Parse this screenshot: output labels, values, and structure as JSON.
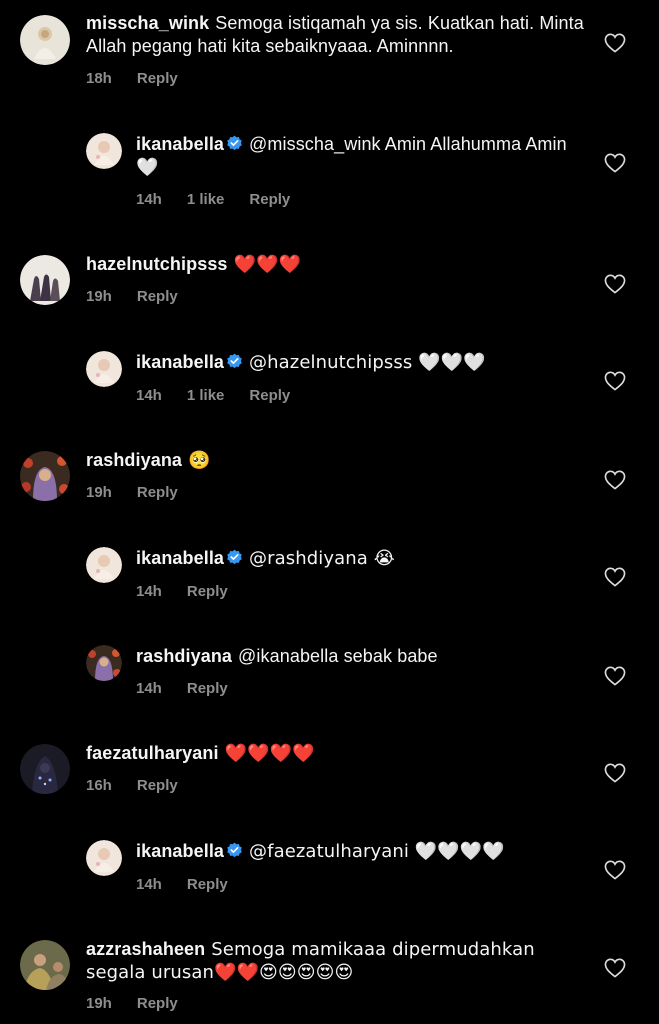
{
  "colors": {
    "background": "#000000",
    "text": "#f5f5f5",
    "meta": "#8e8e8e",
    "verified": "#3897f0"
  },
  "comments": [
    {
      "username": "misscha_wink",
      "text": "Semoga istiqamah ya sis. Kuatkan hati. Minta Allah pegang hati kita sebaiknyaaa. Aminnnn.",
      "time": "18h",
      "likes": "",
      "reply": "Reply",
      "verified": false,
      "is_reply": false,
      "icons": [
        "heart-outline-icon"
      ]
    },
    {
      "username": "ikanabella",
      "text": "@misscha_wink Amin Allahumma Amin 🤍",
      "time": "14h",
      "likes": "1 like",
      "reply": "Reply",
      "verified": true,
      "is_reply": true,
      "icons": [
        "verified-badge-icon",
        "heart-outline-icon"
      ]
    },
    {
      "username": "hazelnutchipsss",
      "text": "❤️❤️❤️",
      "time": "19h",
      "likes": "",
      "reply": "Reply",
      "verified": false,
      "is_reply": false,
      "icons": [
        "heart-outline-icon"
      ]
    },
    {
      "username": "ikanabella",
      "text": "@hazelnutchipsss 🤍🤍🤍",
      "time": "14h",
      "likes": "1 like",
      "reply": "Reply",
      "verified": true,
      "is_reply": true,
      "icons": [
        "verified-badge-icon",
        "heart-outline-icon"
      ]
    },
    {
      "username": "rashdiyana",
      "text": "🥺",
      "time": "19h",
      "likes": "",
      "reply": "Reply",
      "verified": false,
      "is_reply": false,
      "icons": [
        "heart-outline-icon"
      ]
    },
    {
      "username": "ikanabella",
      "text": "@rashdiyana 😭",
      "time": "14h",
      "likes": "",
      "reply": "Reply",
      "verified": true,
      "is_reply": true,
      "icons": [
        "verified-badge-icon",
        "heart-outline-icon"
      ]
    },
    {
      "username": "rashdiyana",
      "text": "@ikanabella sebak babe",
      "time": "14h",
      "likes": "",
      "reply": "Reply",
      "verified": false,
      "is_reply": true,
      "icons": [
        "heart-outline-icon"
      ]
    },
    {
      "username": "faezatulharyani",
      "text": "❤️❤️❤️❤️",
      "time": "16h",
      "likes": "",
      "reply": "Reply",
      "verified": false,
      "is_reply": false,
      "icons": [
        "heart-outline-icon"
      ]
    },
    {
      "username": "ikanabella",
      "text": "@faezatulharyani 🤍🤍🤍🤍",
      "time": "14h",
      "likes": "",
      "reply": "Reply",
      "verified": true,
      "is_reply": true,
      "icons": [
        "verified-badge-icon",
        "heart-outline-icon"
      ]
    },
    {
      "username": "azzrashaheen",
      "text": "Semoga mamikaaa dipermudahkan segala urusan❤️❤️😍😍😍😍😍",
      "time": "19h",
      "likes": "",
      "reply": "Reply",
      "verified": false,
      "is_reply": false,
      "icons": [
        "heart-outline-icon"
      ]
    }
  ]
}
